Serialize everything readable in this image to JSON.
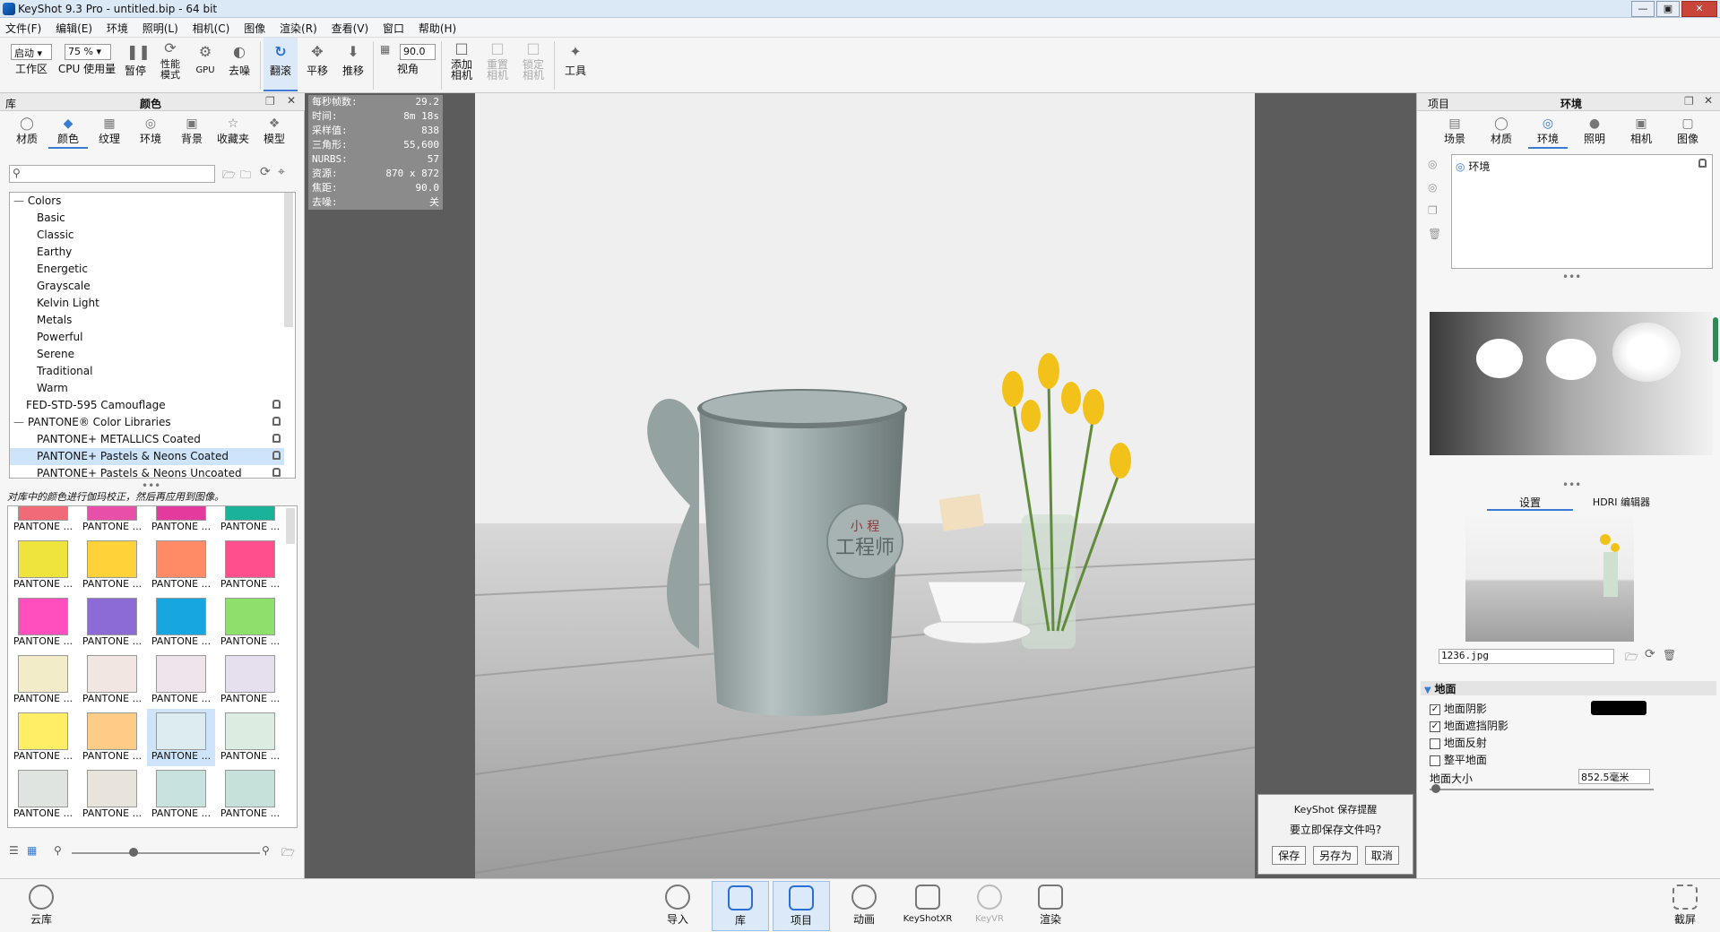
{
  "window": {
    "title": "KeyShot 9.3 Pro  - untitled.bip  - 64 bit"
  },
  "menu": [
    "文件(F)",
    "编辑(E)",
    "环境",
    "照明(L)",
    "相机(C)",
    "图像",
    "渲染(R)",
    "查看(V)",
    "窗口",
    "帮助(H)"
  ],
  "toolbar": {
    "mode_select": "启动",
    "cpu_select": "75 %",
    "fov_value": "90.0",
    "items": [
      {
        "label": "工作区"
      },
      {
        "label": "CPU 使用量"
      },
      {
        "label": "暂停"
      },
      {
        "label": "性能\n模式"
      },
      {
        "label": "GPU"
      },
      {
        "label": "去噪"
      },
      {
        "label": "翻滚"
      },
      {
        "label": "平移"
      },
      {
        "label": "推移"
      },
      {
        "label": "视角"
      },
      {
        "label": "添加\n相机"
      },
      {
        "label": "重置\n相机"
      },
      {
        "label": "锁定\n相机"
      },
      {
        "label": "工具"
      }
    ]
  },
  "left": {
    "header_left": "库",
    "header_center": "颜色",
    "tabs": [
      "材质",
      "颜色",
      "纹理",
      "环境",
      "背景",
      "收藏夹",
      "模型"
    ],
    "tree": [
      {
        "label": "Colors",
        "indent": 0
      },
      {
        "label": "Basic",
        "indent": 1
      },
      {
        "label": "Classic",
        "indent": 1
      },
      {
        "label": "Earthy",
        "indent": 1
      },
      {
        "label": "Energetic",
        "indent": 1
      },
      {
        "label": "Grayscale",
        "indent": 1
      },
      {
        "label": "Kelvin Light",
        "indent": 1
      },
      {
        "label": "Metals",
        "indent": 1
      },
      {
        "label": "Powerful",
        "indent": 1
      },
      {
        "label": "Serene",
        "indent": 1
      },
      {
        "label": "Traditional",
        "indent": 1
      },
      {
        "label": "Warm",
        "indent": 1
      },
      {
        "label": "FED-STD-595 Camouflage",
        "indent": 0,
        "lock": true
      },
      {
        "label": "PANTONE® Color Libraries",
        "indent": 0,
        "lock": true
      },
      {
        "label": "PANTONE+ METALLICS Coated",
        "indent": 1,
        "lock": true
      },
      {
        "label": "PANTONE+ Pastels & Neons Coated",
        "indent": 1,
        "lock": true,
        "selected": true
      },
      {
        "label": "PANTONE+ Pastels & Neons Uncoated",
        "indent": 1,
        "lock": true
      }
    ],
    "hint": "对库中的颜色进行伽玛校正，然后再应用到图像。",
    "swatch_label": "PANTONE ...",
    "swatches": [
      "#f06a78",
      "#e84fa8",
      "#e33a9e",
      "#1ab39a",
      "#efe43c",
      "#ffd23a",
      "#ff8a66",
      "#ff4f8c",
      "#ff4fbe",
      "#8c6bd6",
      "#16a6e0",
      "#8ee06c",
      "#f2ecc8",
      "#f2e6e2",
      "#f0e4ec",
      "#e6e0ee",
      "#ffee66",
      "#ffcc88",
      "#dcecf0",
      "#dcece0",
      "#e0e4e0",
      "#e8e4dc",
      "#c8e2e0",
      "#c4e2da",
      "#f48ca0",
      "#ff6ad0",
      "#f4eedc",
      "#f0e2e2"
    ]
  },
  "stats": [
    [
      "每秒帧数:",
      "29.2"
    ],
    [
      "时间:",
      "8m 18s"
    ],
    [
      "采样值:",
      "838"
    ],
    [
      "三角形:",
      "55,600"
    ],
    [
      "NURBS:",
      "57"
    ],
    [
      "资源:",
      "870 x 872"
    ],
    [
      "焦距:",
      "90.0"
    ],
    [
      "去噪:",
      "关"
    ]
  ],
  "render": {
    "emblem_top": "小 程",
    "emblem_main": "工程师"
  },
  "dialog": {
    "title": "KeyShot 保存提醒",
    "message": "要立即保存文件吗?",
    "save": "保存",
    "save_as": "另存为",
    "cancel": "取消"
  },
  "right": {
    "header_left": "项目",
    "header_center": "环境",
    "tabs": [
      "场景",
      "材质",
      "环境",
      "照明",
      "相机",
      "图像"
    ],
    "env_item": "环境",
    "subtabs": [
      "设置",
      "HDRI 编辑器"
    ],
    "hdri_file": "1236.jpg",
    "ground": {
      "section": "地面",
      "items": [
        {
          "label": "地面阴影",
          "checked": true
        },
        {
          "label": "地面遮挡阴影",
          "checked": true
        },
        {
          "label": "地面反射",
          "checked": false
        },
        {
          "label": "整平地面",
          "checked": false
        }
      ],
      "size_label": "地面大小",
      "size_value": "852.5毫米"
    }
  },
  "bottom": {
    "left": "云库",
    "items": [
      "导入",
      "库",
      "项目",
      "动画",
      "KeyShotXR",
      "KeyVR",
      "渲染"
    ],
    "right": "截屏"
  }
}
